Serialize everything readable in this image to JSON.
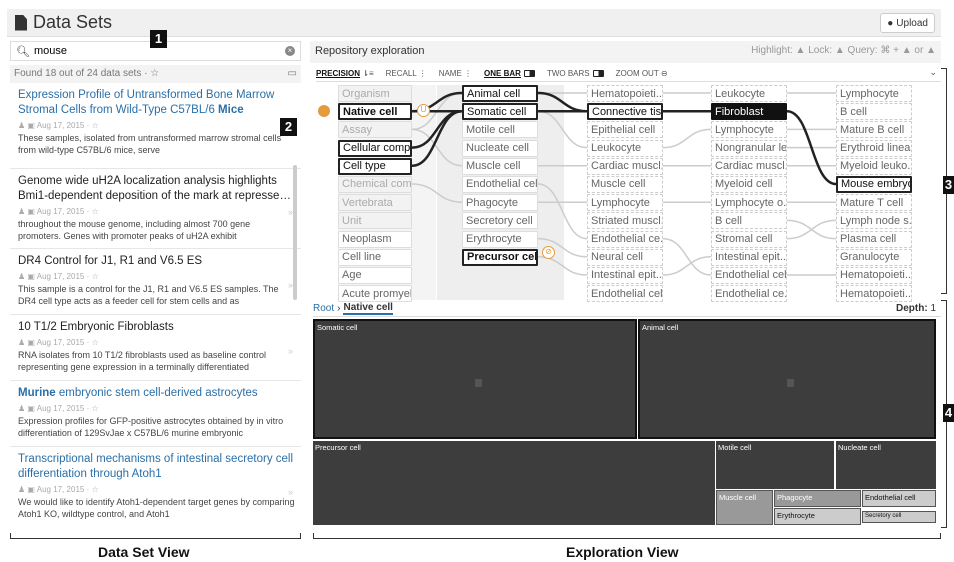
{
  "header": {
    "title": "Data Sets",
    "upload_label": "Upload"
  },
  "badges": {
    "b1": "1",
    "b2": "2",
    "b3": "3",
    "b4": "4"
  },
  "search": {
    "value": "mouse"
  },
  "found": {
    "text": "Found 18 out of 24 data sets · ☆"
  },
  "datasets": [
    {
      "title": "Expression Profile of Untransformed Bone Marrow Stromal Cells from Wild-Type C57BL/6 ",
      "title_em": "Mice",
      "meta": "Aug 17, 2015 · ☆",
      "desc": "These samples, isolated from untransformed marrow stromal cells from wild-type C57BL/6 mice, serve"
    },
    {
      "title": "Genome wide uH2A localization analysis highlights Bmi1-dependent deposition of the mark at represse…",
      "meta": "Aug 17, 2015 · ☆",
      "desc": "throughout the mouse genome, including almost 700 gene promoters. Genes with promoter peaks of uH2A exhibit"
    },
    {
      "title": "DR4 Control for J1, R1 and V6.5 ES",
      "meta": "Aug 17, 2015 · ☆",
      "desc": "This sample is a control for the J1, R1 and V6.5 ES samples. The DR4 cell type acts as a feeder cell for stem cells and as"
    },
    {
      "title": "10 T1/2 Embryonic Fibroblasts",
      "meta": "Aug 17, 2015 · ☆",
      "desc": "RNA isolates from 10 T1/2 fibroblasts used as baseline control representing gene expression in a terminally differentiated"
    },
    {
      "title_em_pre": "Murine",
      "title": " embryonic stem cell-derived astrocytes",
      "meta": "Aug 17, 2015 · ☆",
      "desc": "Expression profiles for GFP-positive astrocytes obtained by in vitro differentiation of 129SvJae x C57BL/6 murine embryonic"
    },
    {
      "title": "Transcriptional mechanisms of intestinal secretory cell differentiation through Atoh1",
      "meta": "Aug 17, 2015 · ☆",
      "desc": "We would like to identify Atoh1-dependent target genes by comparing Atoh1 KO, wildtype control, and Atoh1"
    }
  ],
  "repo": {
    "title": "Repository exploration",
    "highlight": "Highlight: ▲  Lock: ▲  Query: ⌘ + ▲ or ▲"
  },
  "toolbar": {
    "precision": "PRECISION",
    "recall": "RECALL",
    "name": "NAME",
    "one_bar": "ONE BAR",
    "two_bars": "TWO BARS",
    "zoom_out": "ZOOM OUT"
  },
  "columns": [
    [
      "Organism",
      "Native cell",
      "Assay",
      "Cellular comp...",
      "Cell type",
      "Chemical com...",
      "Vertebrata",
      "Unit",
      "Neoplasm",
      "Cell line",
      "Age",
      "Acute promyel..."
    ],
    [
      "Animal cell",
      "Somatic cell",
      "Motile cell",
      "Nucleate cell",
      "Muscle cell",
      "Endothelial cell",
      "Phagocyte",
      "Secretory cell",
      "Erythrocyte",
      "Precursor cell"
    ],
    [
      "Hematopoieti...",
      "Connective tis...",
      "Epithelial cell",
      "Leukocyte",
      "Cardiac muscl...",
      "Muscle cell",
      "Lymphocyte",
      "Striated muscl...",
      "Endothelial ce...",
      "Neural cell",
      "Intestinal epit...",
      "Endothelial cell"
    ],
    [
      "Leukocyte",
      "Fibroblast",
      "Lymphocyte",
      "Nongranular le...",
      "Cardiac muscl...",
      "Myeloid cell",
      "Lymphocyte o...",
      "B cell",
      "Stromal cell",
      "Intestinal epit...",
      "Endothelial cell",
      "Endothelial ce..."
    ],
    [
      "Lymphocyte",
      "B cell",
      "Mature B cell",
      "Erythroid linea...",
      "Myeloid leuko...",
      "Mouse embryo...",
      "Mature T cell",
      "Lymph node s...",
      "Plasma cell",
      "Granulocyte",
      "Hematopoieti...",
      "Hematopoieti..."
    ]
  ],
  "breadcrumb": {
    "root": "Root",
    "sep": "›",
    "current": "Native cell"
  },
  "depth": {
    "label": "Depth:",
    "value": "1"
  },
  "treemap": {
    "somatic": "Somatic cell",
    "animal": "Animal cell",
    "precursor": "Precursor cell",
    "motile": "Motile cell",
    "nucleate": "Nucleate cell",
    "muscle": "Muscle cell",
    "phagocyte": "Phagocyte",
    "endothelial": "Endothelial cell",
    "erythrocyte": "Erythrocyte",
    "secretory": "Secretory cell"
  },
  "footer": {
    "dataset_view": "Data Set View",
    "exploration_view": "Exploration View"
  }
}
